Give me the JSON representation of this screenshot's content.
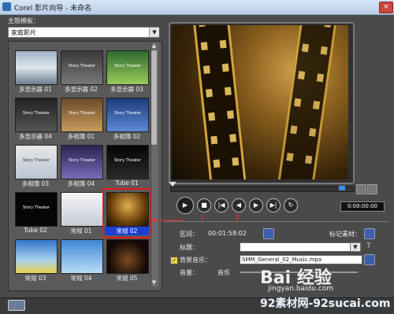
{
  "window": {
    "title": "Corel 影片向导 - 未命名",
    "close_label": "×"
  },
  "left": {
    "template_label": "主题模板：",
    "category_value": "家庭影片",
    "dropdown_arrow": "▼",
    "thumbnails": [
      {
        "label": "多显示器 01",
        "caption": ""
      },
      {
        "label": "多显示器 02",
        "caption": "Story Theater"
      },
      {
        "label": "多显示器 03",
        "caption": "Story Theater"
      },
      {
        "label": "多显示器 04",
        "caption": "Story Theater"
      },
      {
        "label": "多相簿 01",
        "caption": "Story Theater"
      },
      {
        "label": "多相簿 02",
        "caption": "Story Theater"
      },
      {
        "label": "多相簿 03",
        "caption": "Story Theater"
      },
      {
        "label": "多相簿 04",
        "caption": "Story Theater"
      },
      {
        "label": "Tube 01",
        "caption": "Story Theater"
      },
      {
        "label": "Tube 02",
        "caption": "Story Theater"
      },
      {
        "label": "常规 01",
        "caption": ""
      },
      {
        "label": "常规 02",
        "caption": ""
      },
      {
        "label": "常规 03",
        "caption": ""
      },
      {
        "label": "常规 04",
        "caption": ""
      },
      {
        "label": "常规 05",
        "caption": ""
      }
    ]
  },
  "player": {
    "timecode": "0:00:00:00",
    "annotation_1": "1",
    "annotation_2": "2",
    "play_icon": "▶",
    "stop_icon": "■",
    "start_icon": "|◀",
    "prev_icon": "◀",
    "next_icon": "▶",
    "end_icon": "▶|",
    "repeat_icon": "↻"
  },
  "props": {
    "range_label": "区间：",
    "range_value": "00:01:58:02",
    "mark_clip_label": "标记素材：",
    "title_label": "标题：",
    "bg_music_label": "背景音乐：",
    "bg_music_value": "SMM_General_02_Music.mpa",
    "volume_label": "音量：",
    "music_label": "音乐",
    "checkbox_mark": "✓"
  },
  "watermarks": {
    "baidu_text": "Bai 经验",
    "baidu_url": "jingyan.baidu.com",
    "site_text": "92素材网-92sucai.com"
  },
  "colors": {
    "selected_outline": "#e21b1b",
    "selected_label_bg": "#1d3fd1",
    "annotation": "#ff3030"
  }
}
